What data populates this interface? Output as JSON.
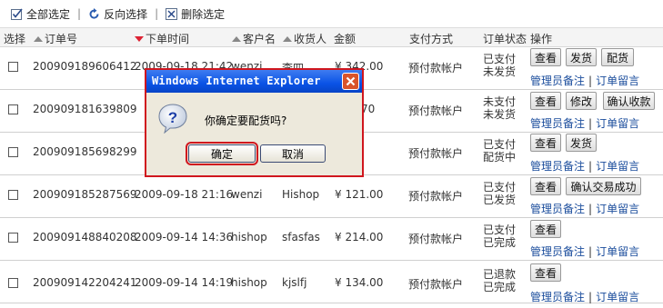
{
  "toolbar": {
    "select_all": "全部选定",
    "sep1": "|",
    "invert": "反向选择",
    "sep2": "|",
    "delete": "删除选定"
  },
  "header": {
    "select": "选择",
    "order_no": "订单号",
    "order_time": "下单时间",
    "customer": "客户名",
    "receiver": "收货人",
    "amount": "金额",
    "payment": "支付方式",
    "status": "订单状态",
    "ops": "操作"
  },
  "rows": [
    {
      "order_no": "200909189606412",
      "time": "2009-09-18 21:42",
      "customer": "wenzi",
      "receiver": "李四",
      "amount": "¥ 342.00",
      "payment": "预付款帐户",
      "status1": "已支付",
      "status2": "未发货",
      "btn1": "查看",
      "btn2": "发货",
      "btn3": "配货",
      "link1": "管理员备注",
      "pipe": "|",
      "link2": "订单留言"
    },
    {
      "order_no": "200909181639809",
      "time": "",
      "customer": "",
      "receiver": "",
      "amount": "70",
      "payment": "预付款帐户",
      "status1": "未支付",
      "status2": "未发货",
      "btn1": "查看",
      "btn2": "修改",
      "btn3": "确认收款",
      "link1": "管理员备注",
      "pipe": "|",
      "link2": "订单留言"
    },
    {
      "order_no": "200909185698299",
      "time": "",
      "customer": "",
      "receiver": "",
      "amount": "",
      "payment": "预付款帐户",
      "status1": "已支付",
      "status2": "配货中",
      "btn1": "查看",
      "btn2": "发货",
      "link1": "管理员备注",
      "pipe": "|",
      "link2": "订单留言"
    },
    {
      "order_no": "200909185287569",
      "time": "2009-09-18 21:16",
      "customer": "wenzi",
      "receiver": "Hishop",
      "amount": "¥ 121.00",
      "payment": "预付款帐户",
      "status1": "已支付",
      "status2": "已发货",
      "btn1": "查看",
      "btn2": "确认交易成功",
      "link1": "管理员备注",
      "pipe": "|",
      "link2": "订单留言"
    },
    {
      "order_no": "200909148840208",
      "time": "2009-09-14 14:36",
      "customer": "hishop",
      "receiver": "sfasfas",
      "amount": "¥ 214.00",
      "payment": "预付款帐户",
      "status1": "已支付",
      "status2": "已完成",
      "btn1": "查看",
      "link1": "管理员备注",
      "pipe": "|",
      "link2": "订单留言"
    },
    {
      "order_no": "200909142204241",
      "time": "2009-09-14 14:19",
      "customer": "hishop",
      "receiver": "kjslfj",
      "amount": "¥ 134.00",
      "payment": "预付款帐户",
      "status1": "已退款",
      "status2": "已完成",
      "btn1": "查看",
      "link1": "管理员备注",
      "pipe": "|",
      "link2": "订单留言"
    }
  ],
  "dialog": {
    "title": "Windows Internet Explorer",
    "message": "你确定要配货吗?",
    "ok": "确定",
    "cancel": "取消"
  }
}
